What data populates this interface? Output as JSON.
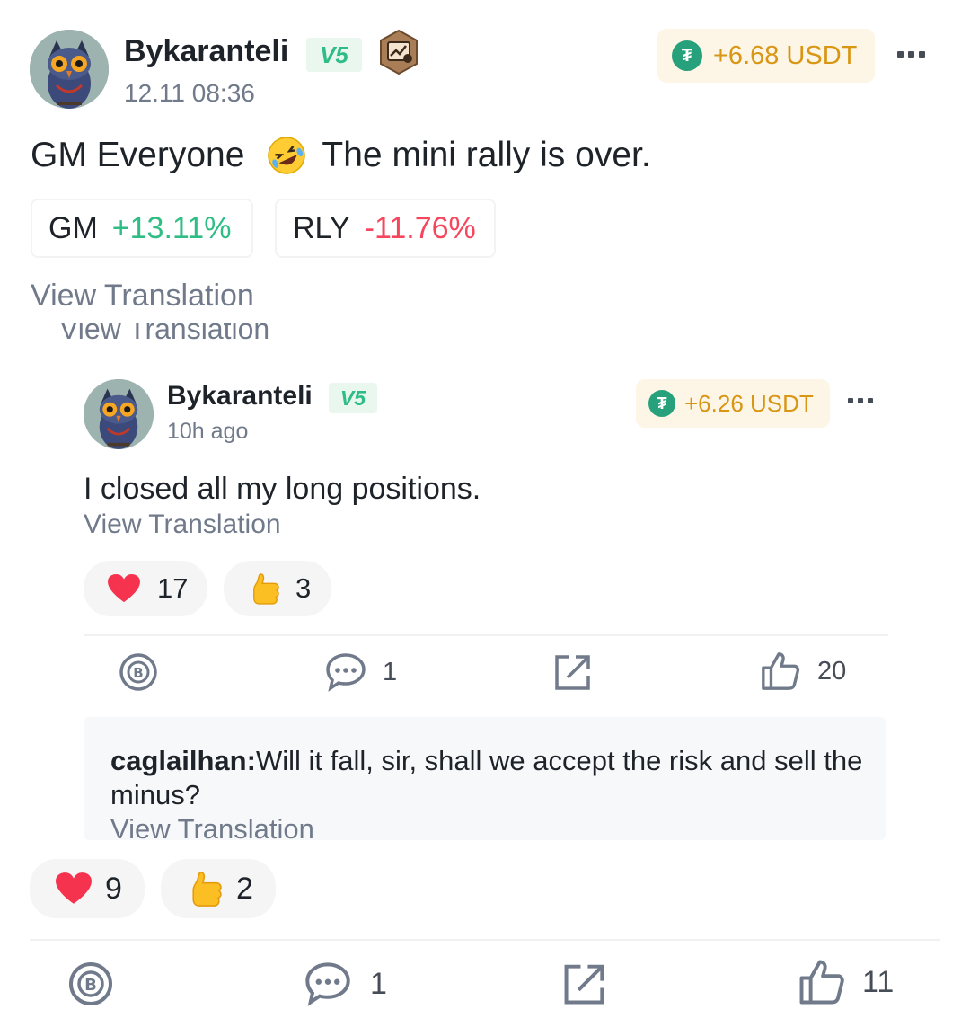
{
  "post": {
    "author": "Bykaranteli",
    "level_badge": "V5",
    "timestamp": "12.11 08:36",
    "tip": "+6.68 USDT",
    "content": {
      "before": "GM Everyone",
      "emoji": "rolling-on-floor-laughing-emoji",
      "after": "The mini rally is over."
    },
    "tickers": [
      {
        "symbol": "GM",
        "change": "+13.11%"
      },
      {
        "symbol": "RLY",
        "change": "-11.76%"
      }
    ],
    "view_translation": "View Translation",
    "reactions": {
      "heart": "9",
      "thumbs": "2"
    },
    "actions": {
      "comments": "1",
      "likes": "11"
    }
  },
  "quoted": {
    "cut_off_translation": "View Translation",
    "author": "Bykaranteli",
    "level_badge": "V5",
    "timestamp": "10h ago",
    "tip": "+6.26 USDT",
    "content": "I closed all my long positions.",
    "view_translation": "View Translation",
    "reactions": {
      "heart": "17",
      "thumbs": "3"
    },
    "actions": {
      "comments": "1",
      "likes": "20"
    },
    "comment": {
      "author": "caglailhan:",
      "text": "Will it fall, sir, shall we accept the risk and sell the minus?",
      "view_translation": "View Translation"
    }
  },
  "colors": {
    "positive": "#2ebd85",
    "negative": "#f6465d",
    "tip_text": "#d89614",
    "usdt": "#26a17b"
  }
}
